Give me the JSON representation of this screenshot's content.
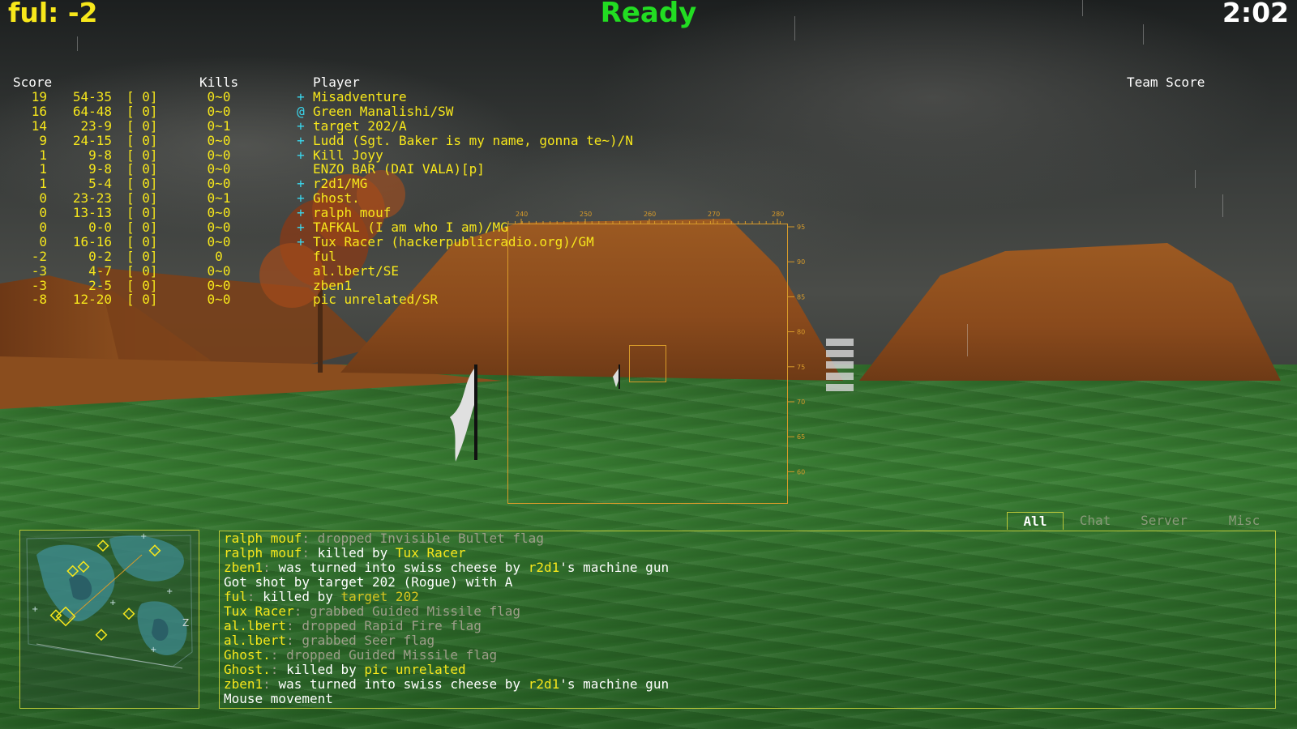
{
  "hud": {
    "score_label": "ful: -2",
    "status": "Ready",
    "timer": "2:02"
  },
  "scoreboard": {
    "headers": {
      "score": "Score",
      "kills": "Kills",
      "player": "Player",
      "team_score": "Team Score"
    },
    "rows": [
      {
        "score": "19",
        "wl": "54-35",
        "bracket": "[ 0]",
        "kills": "0~0",
        "mark": "+",
        "player": "Misadventure"
      },
      {
        "score": "16",
        "wl": "64-48",
        "bracket": "[ 0]",
        "kills": "0~0",
        "mark": "@",
        "player": "Green Manalishi/SW"
      },
      {
        "score": "14",
        "wl": "23-9",
        "bracket": "[ 0]",
        "kills": "0~1",
        "mark": "+",
        "player": "target 202/A"
      },
      {
        "score": "9",
        "wl": "24-15",
        "bracket": "[ 0]",
        "kills": "0~0",
        "mark": "+",
        "player": "Ludd (Sgt. Baker is my name, gonna te~)/N"
      },
      {
        "score": "1",
        "wl": "9-8",
        "bracket": "[ 0]",
        "kills": "0~0",
        "mark": "+",
        "player": "Kill Joyy"
      },
      {
        "score": "1",
        "wl": "9-8",
        "bracket": "[ 0]",
        "kills": "0~0",
        "mark": "",
        "player": "ENZO BAR (DAI VALA)[p]"
      },
      {
        "score": "1",
        "wl": "5-4",
        "bracket": "[ 0]",
        "kills": "0~0",
        "mark": "+",
        "player": "r2d1/MG"
      },
      {
        "score": "0",
        "wl": "23-23",
        "bracket": "[ 0]",
        "kills": "0~1",
        "mark": "+",
        "player": "Ghost."
      },
      {
        "score": "0",
        "wl": "13-13",
        "bracket": "[ 0]",
        "kills": "0~0",
        "mark": "+",
        "player": "ralph mouf"
      },
      {
        "score": "0",
        "wl": "0-0",
        "bracket": "[ 0]",
        "kills": "0~0",
        "mark": "+",
        "player": "TAFKAL (I am who I am)/MG"
      },
      {
        "score": "0",
        "wl": "16-16",
        "bracket": "[ 0]",
        "kills": "0~0",
        "mark": "+",
        "player": "Tux Racer (hackerpublicradio.org)/GM"
      },
      {
        "score": "-2",
        "wl": "0-2",
        "bracket": "[ 0]",
        "kills": "0",
        "mark": "",
        "player": "ful"
      },
      {
        "score": "-3",
        "wl": "4-7",
        "bracket": "[ 0]",
        "kills": "0~0",
        "mark": "",
        "player": "al.lbert/SE"
      },
      {
        "score": "-3",
        "wl": "2-5",
        "bracket": "[ 0]",
        "kills": "0~0",
        "mark": "",
        "player": "zben1"
      },
      {
        "score": "-8",
        "wl": "12-20",
        "bracket": "[ 0]",
        "kills": "0~0",
        "mark": "",
        "player": "pic unrelated/SR"
      }
    ]
  },
  "reticle": {
    "x_ticks": [
      "240",
      "250",
      "260",
      "270",
      "280"
    ],
    "y_ticks": [
      "95",
      "90",
      "85",
      "80",
      "75",
      "70",
      "65",
      "60"
    ]
  },
  "console": {
    "tabs": [
      "All",
      "Chat",
      "Server",
      "Misc"
    ],
    "active_tab": "All",
    "lines": [
      [
        {
          "t": "ralph mouf",
          "c": "yel"
        },
        {
          "t": ": ",
          "c": "grey"
        },
        {
          "t": "dropped Invisible Bullet flag",
          "c": "grey"
        }
      ],
      [
        {
          "t": "ralph mouf",
          "c": "yel"
        },
        {
          "t": ": ",
          "c": "grey"
        },
        {
          "t": "killed by ",
          "c": "white"
        },
        {
          "t": "Tux Racer",
          "c": "yel"
        }
      ],
      [
        {
          "t": "zben1",
          "c": "yel"
        },
        {
          "t": ": ",
          "c": "grey"
        },
        {
          "t": "was turned into swiss cheese by ",
          "c": "white"
        },
        {
          "t": "r2d1",
          "c": "yel"
        },
        {
          "t": "'s machine gun",
          "c": "white"
        }
      ],
      [
        {
          "t": "Got shot by target 202 (Rogue) with A",
          "c": "white"
        }
      ],
      [
        {
          "t": "ful",
          "c": "yel"
        },
        {
          "t": ": ",
          "c": "grey"
        },
        {
          "t": "killed by ",
          "c": "white"
        },
        {
          "t": "target 202",
          "c": "gold"
        }
      ],
      [
        {
          "t": "Tux Racer",
          "c": "yel"
        },
        {
          "t": ": ",
          "c": "grey"
        },
        {
          "t": "grabbed Guided Missile flag",
          "c": "grey"
        }
      ],
      [
        {
          "t": "al.lbert",
          "c": "yel"
        },
        {
          "t": ": ",
          "c": "grey"
        },
        {
          "t": "dropped Rapid Fire flag",
          "c": "grey"
        }
      ],
      [
        {
          "t": "al.lbert",
          "c": "yel"
        },
        {
          "t": ": ",
          "c": "grey"
        },
        {
          "t": "grabbed Seer flag",
          "c": "grey"
        }
      ],
      [
        {
          "t": "Ghost.",
          "c": "yel"
        },
        {
          "t": ": ",
          "c": "grey"
        },
        {
          "t": "dropped Guided Missile flag",
          "c": "grey"
        }
      ],
      [
        {
          "t": "Ghost.",
          "c": "yel"
        },
        {
          "t": ": ",
          "c": "grey"
        },
        {
          "t": "killed by ",
          "c": "white"
        },
        {
          "t": "pic unrelated",
          "c": "yel"
        }
      ],
      [
        {
          "t": "zben1",
          "c": "yel"
        },
        {
          "t": ": ",
          "c": "grey"
        },
        {
          "t": "was turned into swiss cheese by ",
          "c": "white"
        },
        {
          "t": "r2d1",
          "c": "yel"
        },
        {
          "t": "'s machine gun",
          "c": "white"
        }
      ],
      [
        {
          "t": "Mouse movement",
          "c": "white"
        }
      ]
    ]
  },
  "radar": {
    "north_marker": "Z"
  },
  "colors": {
    "hud_yellow": "#f7e71b",
    "ready_green": "#22dd22",
    "reticle_orange": "#d89b2a",
    "console_border": "#b9c73a",
    "team_marker_cyan": "#3ad7ee"
  }
}
